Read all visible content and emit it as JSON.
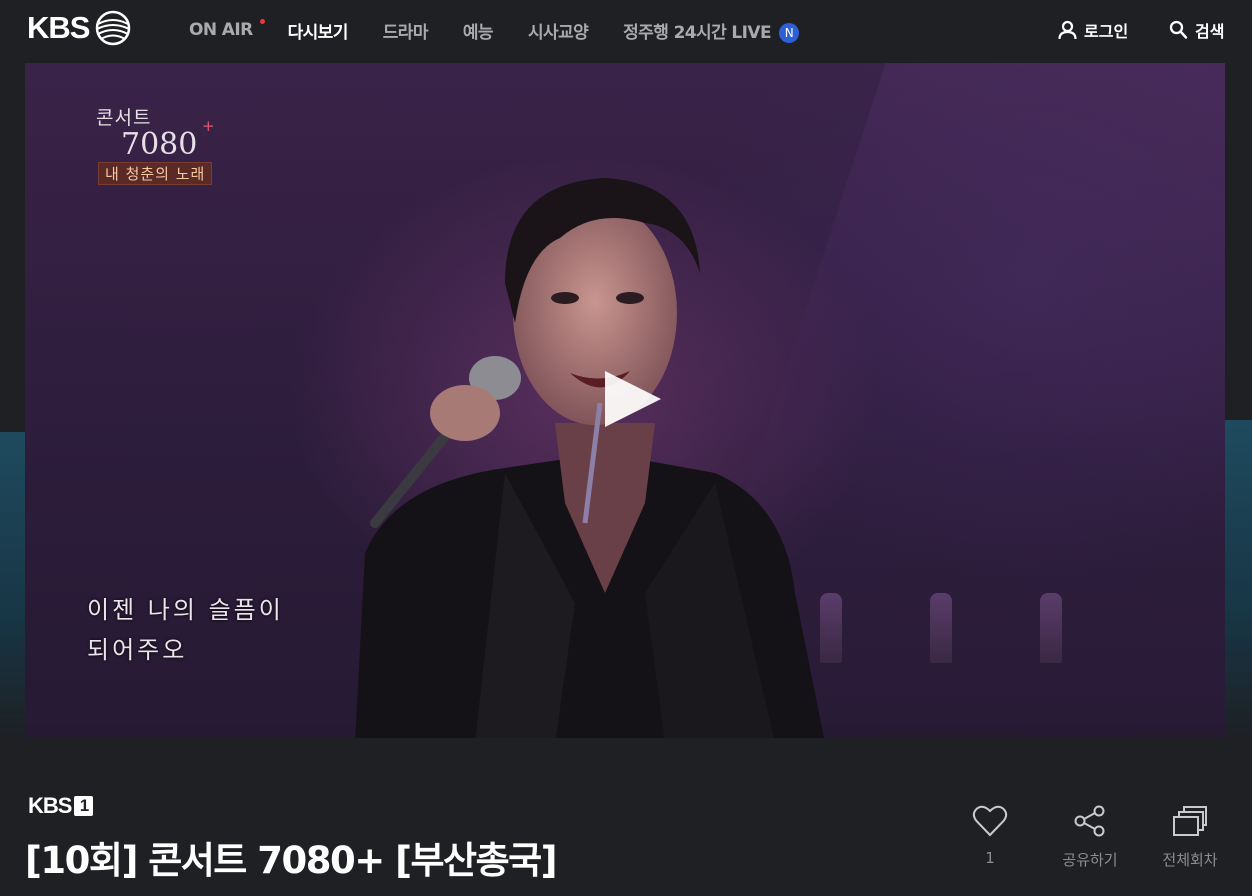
{
  "header": {
    "logo_text": "KBS",
    "nav": [
      {
        "label": "ON AIR",
        "active": false,
        "dot": true
      },
      {
        "label": "다시보기",
        "active": true
      },
      {
        "label": "드라마",
        "active": false
      },
      {
        "label": "예능",
        "active": false
      },
      {
        "label": "시사교양",
        "active": false
      },
      {
        "label": "정주행 24시간 LIVE",
        "active": false,
        "badge": "N"
      }
    ],
    "login_label": "로그인",
    "search_label": "검색"
  },
  "video": {
    "program_logo": {
      "title": "콘서트",
      "number": "7080",
      "plus": "+",
      "sub": "내 청춘의 노래"
    },
    "subtitle_lines": [
      "이젠 나의 슬픔이",
      "되어주오"
    ],
    "play_icon": "play-icon"
  },
  "info": {
    "channel": "KBS",
    "channel_number": "1",
    "title": "[10회] 콘서트 7080+ [부산총국]",
    "actions": [
      {
        "icon": "heart-icon",
        "label": "1"
      },
      {
        "icon": "share-icon",
        "label": "공유하기"
      },
      {
        "icon": "episodes-icon",
        "label": "전체회차"
      }
    ]
  },
  "colors": {
    "background": "#1e2024",
    "nav_inactive": "#a9aaae",
    "nav_active": "#ffffff",
    "live_badge": "#2d5fd6",
    "action_text": "#8c8d91"
  }
}
